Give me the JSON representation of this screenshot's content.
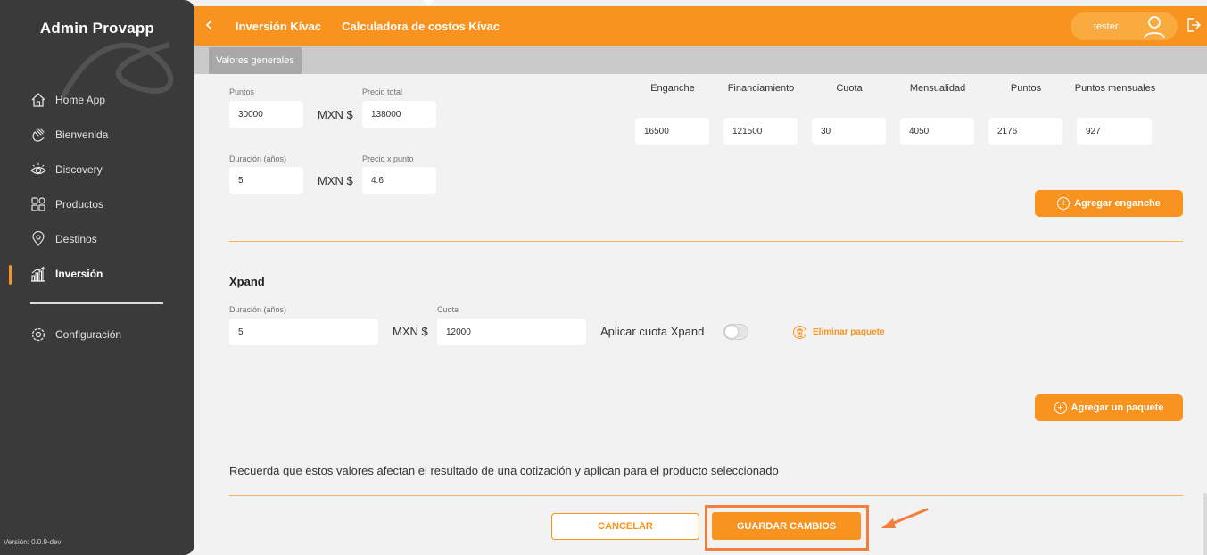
{
  "app": {
    "brand": "Admin Provapp",
    "version": "Versión: 0.0.9-dev"
  },
  "sidebar": {
    "items": [
      {
        "label": "Home App",
        "icon": "home-icon"
      },
      {
        "label": "Bienvenida",
        "icon": "wave-hand-icon"
      },
      {
        "label": "Discovery",
        "icon": "eye-icon"
      },
      {
        "label": "Productos",
        "icon": "grid-icon"
      },
      {
        "label": "Destinos",
        "icon": "location-pin-icon"
      },
      {
        "label": "Inversión",
        "icon": "bar-chart-icon",
        "active": true
      }
    ],
    "config": {
      "label": "Configuración",
      "icon": "gear-icon"
    }
  },
  "header": {
    "breadcrumb_1": "Inversión Kívac",
    "breadcrumb_2": "Calculadora de costos Kívac",
    "user": "tester",
    "accent": "#f7931e"
  },
  "tabs": {
    "active": "Valores generales"
  },
  "kivac": {
    "puntos_label": "Puntos",
    "puntos_value": "30000",
    "precio_total_label": "Precio total",
    "precio_total_value": "138000",
    "duracion_label": "Duración (años)",
    "duracion_value": "5",
    "precio_punto_label": "Precio x punto",
    "precio_punto_value": "4.6",
    "currency": "MXN $",
    "enganche": {
      "headers": [
        "Enganche",
        "Financiamiento",
        "Cuota",
        "Mensualidad",
        "Puntos",
        "Puntos mensuales"
      ],
      "values": [
        "16500",
        "121500",
        "30",
        "4050",
        "2176",
        "927"
      ]
    },
    "add_enganche": "Agregar enganche"
  },
  "xpand": {
    "title": "Xpand",
    "duracion_label": "Duración (años)",
    "duracion_value": "5",
    "cuota_label": "Cuota",
    "cuota_value": "12000",
    "currency": "MXN $",
    "toggle_label": "Aplicar cuota Xpand",
    "toggle_on": false,
    "delete_label": "Eliminar paquete"
  },
  "add_package": "Agregar un paquete",
  "note": "Recuerda que estos valores afectan el resultado de una cotización y aplican para el producto seleccionado",
  "actions": {
    "cancel": "CANCELAR",
    "save": "GUARDAR CAMBIOS"
  }
}
